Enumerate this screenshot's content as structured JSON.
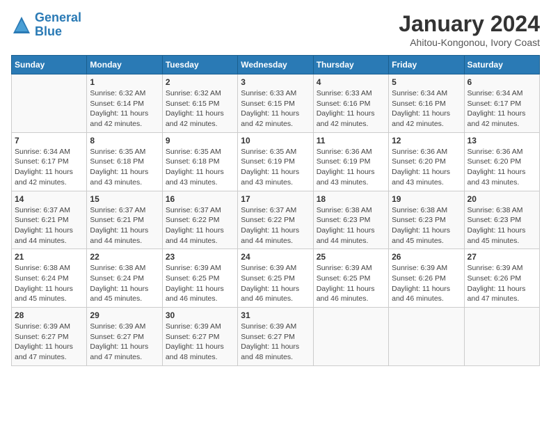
{
  "logo": {
    "line1": "General",
    "line2": "Blue"
  },
  "title": "January 2024",
  "subtitle": "Ahitou-Kongonou, Ivory Coast",
  "weekdays": [
    "Sunday",
    "Monday",
    "Tuesday",
    "Wednesday",
    "Thursday",
    "Friday",
    "Saturday"
  ],
  "weeks": [
    [
      {
        "day": "",
        "sunrise": "",
        "sunset": "",
        "daylight": ""
      },
      {
        "day": "1",
        "sunrise": "Sunrise: 6:32 AM",
        "sunset": "Sunset: 6:14 PM",
        "daylight": "Daylight: 11 hours and 42 minutes."
      },
      {
        "day": "2",
        "sunrise": "Sunrise: 6:32 AM",
        "sunset": "Sunset: 6:15 PM",
        "daylight": "Daylight: 11 hours and 42 minutes."
      },
      {
        "day": "3",
        "sunrise": "Sunrise: 6:33 AM",
        "sunset": "Sunset: 6:15 PM",
        "daylight": "Daylight: 11 hours and 42 minutes."
      },
      {
        "day": "4",
        "sunrise": "Sunrise: 6:33 AM",
        "sunset": "Sunset: 6:16 PM",
        "daylight": "Daylight: 11 hours and 42 minutes."
      },
      {
        "day": "5",
        "sunrise": "Sunrise: 6:34 AM",
        "sunset": "Sunset: 6:16 PM",
        "daylight": "Daylight: 11 hours and 42 minutes."
      },
      {
        "day": "6",
        "sunrise": "Sunrise: 6:34 AM",
        "sunset": "Sunset: 6:17 PM",
        "daylight": "Daylight: 11 hours and 42 minutes."
      }
    ],
    [
      {
        "day": "7",
        "sunrise": "Sunrise: 6:34 AM",
        "sunset": "Sunset: 6:17 PM",
        "daylight": "Daylight: 11 hours and 42 minutes."
      },
      {
        "day": "8",
        "sunrise": "Sunrise: 6:35 AM",
        "sunset": "Sunset: 6:18 PM",
        "daylight": "Daylight: 11 hours and 43 minutes."
      },
      {
        "day": "9",
        "sunrise": "Sunrise: 6:35 AM",
        "sunset": "Sunset: 6:18 PM",
        "daylight": "Daylight: 11 hours and 43 minutes."
      },
      {
        "day": "10",
        "sunrise": "Sunrise: 6:35 AM",
        "sunset": "Sunset: 6:19 PM",
        "daylight": "Daylight: 11 hours and 43 minutes."
      },
      {
        "day": "11",
        "sunrise": "Sunrise: 6:36 AM",
        "sunset": "Sunset: 6:19 PM",
        "daylight": "Daylight: 11 hours and 43 minutes."
      },
      {
        "day": "12",
        "sunrise": "Sunrise: 6:36 AM",
        "sunset": "Sunset: 6:20 PM",
        "daylight": "Daylight: 11 hours and 43 minutes."
      },
      {
        "day": "13",
        "sunrise": "Sunrise: 6:36 AM",
        "sunset": "Sunset: 6:20 PM",
        "daylight": "Daylight: 11 hours and 43 minutes."
      }
    ],
    [
      {
        "day": "14",
        "sunrise": "Sunrise: 6:37 AM",
        "sunset": "Sunset: 6:21 PM",
        "daylight": "Daylight: 11 hours and 44 minutes."
      },
      {
        "day": "15",
        "sunrise": "Sunrise: 6:37 AM",
        "sunset": "Sunset: 6:21 PM",
        "daylight": "Daylight: 11 hours and 44 minutes."
      },
      {
        "day": "16",
        "sunrise": "Sunrise: 6:37 AM",
        "sunset": "Sunset: 6:22 PM",
        "daylight": "Daylight: 11 hours and 44 minutes."
      },
      {
        "day": "17",
        "sunrise": "Sunrise: 6:37 AM",
        "sunset": "Sunset: 6:22 PM",
        "daylight": "Daylight: 11 hours and 44 minutes."
      },
      {
        "day": "18",
        "sunrise": "Sunrise: 6:38 AM",
        "sunset": "Sunset: 6:23 PM",
        "daylight": "Daylight: 11 hours and 44 minutes."
      },
      {
        "day": "19",
        "sunrise": "Sunrise: 6:38 AM",
        "sunset": "Sunset: 6:23 PM",
        "daylight": "Daylight: 11 hours and 45 minutes."
      },
      {
        "day": "20",
        "sunrise": "Sunrise: 6:38 AM",
        "sunset": "Sunset: 6:23 PM",
        "daylight": "Daylight: 11 hours and 45 minutes."
      }
    ],
    [
      {
        "day": "21",
        "sunrise": "Sunrise: 6:38 AM",
        "sunset": "Sunset: 6:24 PM",
        "daylight": "Daylight: 11 hours and 45 minutes."
      },
      {
        "day": "22",
        "sunrise": "Sunrise: 6:38 AM",
        "sunset": "Sunset: 6:24 PM",
        "daylight": "Daylight: 11 hours and 45 minutes."
      },
      {
        "day": "23",
        "sunrise": "Sunrise: 6:39 AM",
        "sunset": "Sunset: 6:25 PM",
        "daylight": "Daylight: 11 hours and 46 minutes."
      },
      {
        "day": "24",
        "sunrise": "Sunrise: 6:39 AM",
        "sunset": "Sunset: 6:25 PM",
        "daylight": "Daylight: 11 hours and 46 minutes."
      },
      {
        "day": "25",
        "sunrise": "Sunrise: 6:39 AM",
        "sunset": "Sunset: 6:25 PM",
        "daylight": "Daylight: 11 hours and 46 minutes."
      },
      {
        "day": "26",
        "sunrise": "Sunrise: 6:39 AM",
        "sunset": "Sunset: 6:26 PM",
        "daylight": "Daylight: 11 hours and 46 minutes."
      },
      {
        "day": "27",
        "sunrise": "Sunrise: 6:39 AM",
        "sunset": "Sunset: 6:26 PM",
        "daylight": "Daylight: 11 hours and 47 minutes."
      }
    ],
    [
      {
        "day": "28",
        "sunrise": "Sunrise: 6:39 AM",
        "sunset": "Sunset: 6:27 PM",
        "daylight": "Daylight: 11 hours and 47 minutes."
      },
      {
        "day": "29",
        "sunrise": "Sunrise: 6:39 AM",
        "sunset": "Sunset: 6:27 PM",
        "daylight": "Daylight: 11 hours and 47 minutes."
      },
      {
        "day": "30",
        "sunrise": "Sunrise: 6:39 AM",
        "sunset": "Sunset: 6:27 PM",
        "daylight": "Daylight: 11 hours and 48 minutes."
      },
      {
        "day": "31",
        "sunrise": "Sunrise: 6:39 AM",
        "sunset": "Sunset: 6:27 PM",
        "daylight": "Daylight: 11 hours and 48 minutes."
      },
      {
        "day": "",
        "sunrise": "",
        "sunset": "",
        "daylight": ""
      },
      {
        "day": "",
        "sunrise": "",
        "sunset": "",
        "daylight": ""
      },
      {
        "day": "",
        "sunrise": "",
        "sunset": "",
        "daylight": ""
      }
    ]
  ]
}
